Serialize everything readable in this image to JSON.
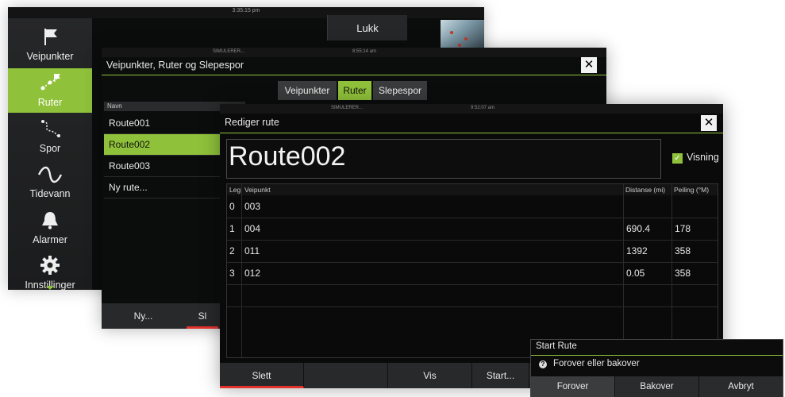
{
  "main_window": {
    "clock": "3:35:15 pm",
    "close_label": "Lukk",
    "sidebar": [
      {
        "label": "Veipunkter",
        "icon": "flag-icon",
        "active": false
      },
      {
        "label": "Ruter",
        "icon": "route-icon",
        "active": true
      },
      {
        "label": "Spor",
        "icon": "trail-icon",
        "active": false
      },
      {
        "label": "Tidevann",
        "icon": "wave-icon",
        "active": false
      },
      {
        "label": "Alarmer",
        "icon": "bell-icon",
        "active": false
      },
      {
        "label": "Innstillinger",
        "icon": "gear-icon",
        "active": false
      }
    ]
  },
  "routes_window": {
    "status_left": "SIMULERER...",
    "status_time": "8:55:14 am",
    "title": "Veipunkter, Ruter og Slepespor",
    "tabs": [
      "Veipunkter",
      "Ruter",
      "Slepespor"
    ],
    "selected_tab": "Ruter",
    "list_header": "Navn",
    "routes": [
      "Route001",
      "Route002",
      "Route003",
      "Ny rute..."
    ],
    "selected_route": "Route002",
    "bottom_new": "Ny...",
    "bottom_partial": "Sl"
  },
  "edit_window": {
    "status_left": "SIMULERER...",
    "status_time": "9:52:07 am",
    "title": "Rediger rute",
    "route_name": "Route002",
    "visibility_label": "Visning",
    "visibility_checked": true,
    "columns": {
      "leg": "Leg",
      "waypoint": "Veipunkt",
      "distance": "Distanse (mi)",
      "bearing": "Peiling (°M)"
    },
    "rows": [
      {
        "leg": "0",
        "waypoint": "003",
        "distance": "",
        "bearing": ""
      },
      {
        "leg": "1",
        "waypoint": "004",
        "distance": "690.4",
        "bearing": "178"
      },
      {
        "leg": "2",
        "waypoint": "011",
        "distance": "1392",
        "bearing": "358"
      },
      {
        "leg": "3",
        "waypoint": "012",
        "distance": "0.05",
        "bearing": "358"
      }
    ],
    "buttons": {
      "delete": "Slett",
      "show": "Vis",
      "start": "Start..."
    }
  },
  "start_dialog": {
    "title": "Start Rute",
    "question": "Forover eller bakover",
    "buttons": {
      "forward": "Forover",
      "backward": "Bakover",
      "cancel": "Avbryt"
    }
  },
  "colors": {
    "accent": "#8fc13a",
    "danger": "#e2322b",
    "panel": "#0b0c0c"
  }
}
